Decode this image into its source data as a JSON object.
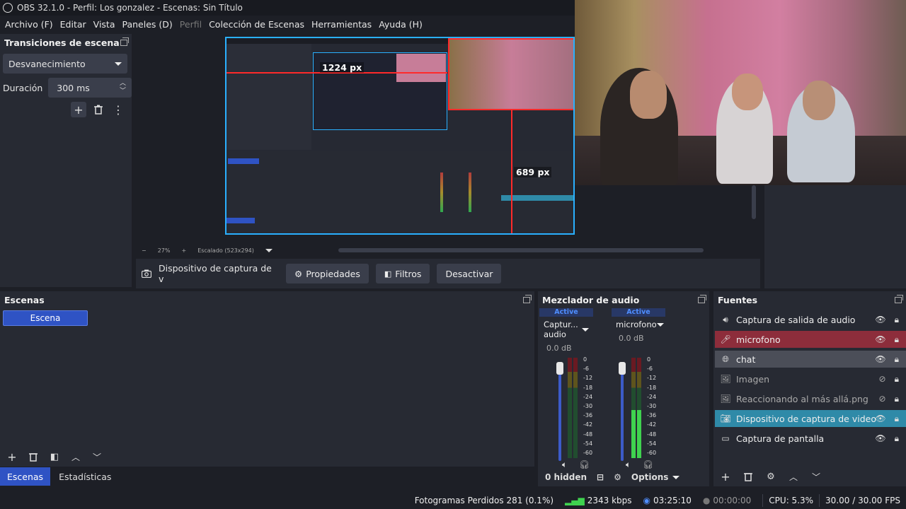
{
  "window": {
    "title": "OBS 32.1.0 - Perfil: Los gonzalez - Escenas: Sin Título"
  },
  "menu": [
    "Archivo (F)",
    "Editar",
    "Vista",
    "Paneles (D)",
    "Perfil",
    "Colección de Escenas",
    "Herramientas",
    "Ayuda (H)"
  ],
  "transitions": {
    "title": "Transiciones de escena",
    "selected": "Desvanecimiento",
    "duration_label": "Duración",
    "duration_value": "300 ms"
  },
  "preview": {
    "width_label": "1224 px",
    "height_label": "689 px",
    "zoom": "27%",
    "scaled": "Escalado (523x294)"
  },
  "context": {
    "source_name": "Dispositivo de captura de v",
    "properties": "Propiedades",
    "filters": "Filtros",
    "deactivate": "Desactivar"
  },
  "scenes": {
    "title": "Escenas",
    "items": [
      "Escena"
    ]
  },
  "mixer": {
    "title": "Mezclador de audio",
    "channels": [
      {
        "active": "Active",
        "name": "Captur... audio",
        "db": "0.0 dB"
      },
      {
        "active": "Active",
        "name": "microfono",
        "db": "0.0 dB"
      }
    ],
    "scale": [
      "0",
      "-6",
      "-12",
      "-18",
      "-24",
      "-30",
      "-36",
      "-42",
      "-48",
      "-54",
      "-60"
    ],
    "hidden": "0 hidden",
    "options": "Options"
  },
  "sources": {
    "title": "Fuentes",
    "items": [
      {
        "name": "Captura de salida de audio",
        "icon": "speaker-icon"
      },
      {
        "name": "microfono",
        "icon": "microphone-icon"
      },
      {
        "name": "chat",
        "icon": "browser-icon"
      },
      {
        "name": "Imagen",
        "icon": "image-icon"
      },
      {
        "name": "Reaccionando al más allá.png",
        "icon": "image-icon"
      },
      {
        "name": "Dispositivo de captura de video",
        "icon": "camera-icon"
      },
      {
        "name": "Captura de pantalla",
        "icon": "monitor-icon"
      }
    ]
  },
  "tabs": [
    "Escenas",
    "Estadísticas"
  ],
  "status": {
    "dropped": "Fotogramas Perdidos 281 (0.1%)",
    "bitrate": "2343 kbps",
    "stream_time": "03:25:10",
    "rec_time": "00:00:00",
    "cpu": "CPU: 5.3%",
    "fps": "30.00 / 30.00 FPS"
  },
  "colors": {
    "accent": "#2f53c4",
    "selection_outline": "#2ab0ff",
    "guide_red": "#ff2a2a",
    "source_red": "#8d2d3b",
    "source_teal": "#2f8aa8"
  }
}
